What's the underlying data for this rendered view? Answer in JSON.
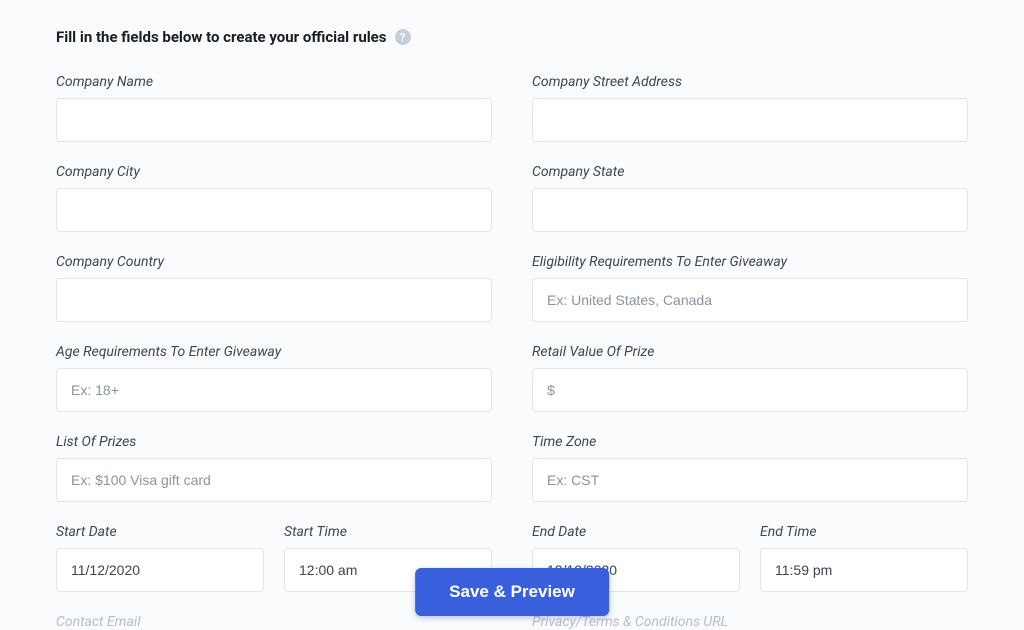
{
  "header": {
    "title": "Fill in the fields below to create your official rules",
    "help_tooltip": "?"
  },
  "fields": {
    "company_name": {
      "label": "Company Name",
      "value": "",
      "placeholder": ""
    },
    "company_street": {
      "label": "Company Street Address",
      "value": "",
      "placeholder": ""
    },
    "company_city": {
      "label": "Company City",
      "value": "",
      "placeholder": ""
    },
    "company_state": {
      "label": "Company State",
      "value": "",
      "placeholder": ""
    },
    "company_country": {
      "label": "Company Country",
      "value": "",
      "placeholder": ""
    },
    "eligibility": {
      "label": "Eligibility Requirements To Enter Giveaway",
      "value": "",
      "placeholder": "Ex: United States, Canada"
    },
    "age_req": {
      "label": "Age Requirements To Enter Giveaway",
      "value": "",
      "placeholder": "Ex: 18+"
    },
    "retail_value": {
      "label": "Retail Value Of Prize",
      "value": "",
      "placeholder": "$"
    },
    "prizes": {
      "label": "List Of Prizes",
      "value": "",
      "placeholder": "Ex: $100 Visa gift card"
    },
    "timezone": {
      "label": "Time Zone",
      "value": "",
      "placeholder": "Ex: CST"
    },
    "start_date": {
      "label": "Start Date",
      "value": "11/12/2020",
      "placeholder": ""
    },
    "start_time": {
      "label": "Start Time",
      "value": "12:00 am",
      "placeholder": ""
    },
    "end_date": {
      "label": "End Date",
      "value": "12/12/2020",
      "placeholder": ""
    },
    "end_time": {
      "label": "End Time",
      "value": "11:59 pm",
      "placeholder": ""
    },
    "contact_email": {
      "label": "Contact Email",
      "value": "",
      "placeholder": ""
    },
    "privacy_url": {
      "label": "Privacy/Terms & Conditions URL",
      "value": "",
      "placeholder": ""
    }
  },
  "actions": {
    "save_label": "Save & Preview"
  }
}
